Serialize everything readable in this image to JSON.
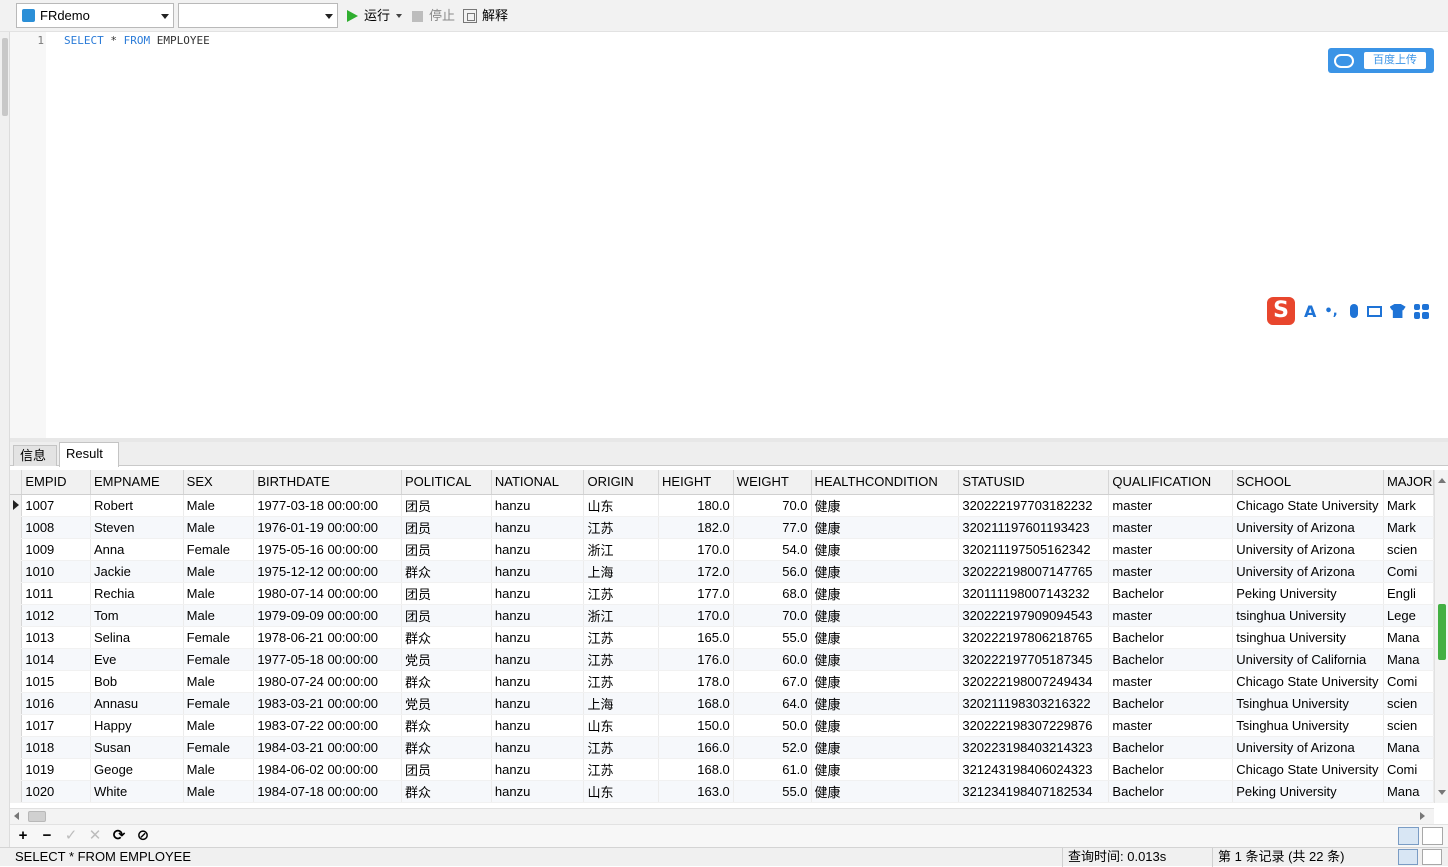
{
  "toolbar": {
    "connection": "FRdemo",
    "database": "",
    "run_label": "运行",
    "stop_label": "停止",
    "explain_label": "解释"
  },
  "editor": {
    "line_number": "1",
    "sql_select": "SELECT",
    "sql_star": " * ",
    "sql_from": "FROM",
    "sql_table": " EMPLOYEE"
  },
  "cloud": {
    "label": "百度上传",
    "icon": "baidu-cloud-icon"
  },
  "ime": {
    "logo": "S",
    "mode": "A",
    "punct": "•,",
    "icons": [
      "mic-icon",
      "keyboard-icon",
      "skin-icon",
      "toolbox-icon"
    ]
  },
  "tabs": [
    {
      "label": "信息",
      "active": false
    },
    {
      "label": "Result 1",
      "active": true
    }
  ],
  "grid": {
    "columns": [
      "EMPID",
      "EMPNAME",
      "SEX",
      "BIRTHDATE",
      "POLITICAL",
      "NATIONAL",
      "ORIGIN",
      "HEIGHT",
      "WEIGHT",
      "HEALTHCONDITION",
      "STATUSID",
      "QUALIFICATION",
      "SCHOOL",
      "MAJOR"
    ],
    "rows": [
      [
        "1007",
        "Robert",
        "Male",
        "1977-03-18 00:00:00",
        "团员",
        "hanzu",
        "山东",
        "180.0",
        "70.0",
        "健康",
        "320222197703182232",
        "master",
        "Chicago State University",
        "Mark"
      ],
      [
        "1008",
        "Steven",
        "Male",
        "1976-01-19 00:00:00",
        "团员",
        "hanzu",
        "江苏",
        "182.0",
        "77.0",
        "健康",
        "320211197601193423",
        "master",
        "University of Arizona",
        "Mark"
      ],
      [
        "1009",
        "Anna",
        "Female",
        "1975-05-16 00:00:00",
        "团员",
        "hanzu",
        "浙江",
        "170.0",
        "54.0",
        "健康",
        "320211197505162342",
        "master",
        "University of Arizona",
        "scien"
      ],
      [
        "1010",
        "Jackie",
        "Male",
        "1975-12-12 00:00:00",
        "群众",
        "hanzu",
        "上海",
        "172.0",
        "56.0",
        "健康",
        "320222198007147765",
        "master",
        "University of Arizona",
        "Comi"
      ],
      [
        "1011",
        "Rechia",
        "Male",
        "1980-07-14 00:00:00",
        "团员",
        "hanzu",
        "江苏",
        "177.0",
        "68.0",
        "健康",
        "320111198007143232",
        "Bachelor",
        "Peking University",
        "Engli"
      ],
      [
        "1012",
        "Tom",
        "Male",
        "1979-09-09 00:00:00",
        "团员",
        "hanzu",
        "浙江",
        "170.0",
        "70.0",
        "健康",
        "320222197909094543",
        "master",
        "tsinghua University",
        "Lege"
      ],
      [
        "1013",
        "Selina",
        "Female",
        "1978-06-21 00:00:00",
        "群众",
        "hanzu",
        "江苏",
        "165.0",
        "55.0",
        "健康",
        "320222197806218765",
        "Bachelor",
        "tsinghua University",
        "Mana"
      ],
      [
        "1014",
        "Eve",
        "Female",
        "1977-05-18 00:00:00",
        "党员",
        "hanzu",
        "江苏",
        "176.0",
        "60.0",
        "健康",
        "320222197705187345",
        "Bachelor",
        "University of California",
        "Mana"
      ],
      [
        "1015",
        "Bob",
        "Male",
        "1980-07-24 00:00:00",
        "群众",
        "hanzu",
        "江苏",
        "178.0",
        "67.0",
        "健康",
        "320222198007249434",
        "master",
        "Chicago State University",
        "Comi"
      ],
      [
        "1016",
        "Annasu",
        "Female",
        "1983-03-21 00:00:00",
        "党员",
        "hanzu",
        "上海",
        "168.0",
        "64.0",
        "健康",
        "320211198303216322",
        "Bachelor",
        "Tsinghua University",
        "scien"
      ],
      [
        "1017",
        "Happy",
        "Male",
        "1983-07-22 00:00:00",
        "群众",
        "hanzu",
        "山东",
        "150.0",
        "50.0",
        "健康",
        "320222198307229876",
        "master",
        "Tsinghua University",
        "scien"
      ],
      [
        "1018",
        "Susan",
        "Female",
        "1984-03-21 00:00:00",
        "群众",
        "hanzu",
        "江苏",
        "166.0",
        "52.0",
        "健康",
        "320223198403214323",
        "Bachelor",
        "University of Arizona",
        "Mana"
      ],
      [
        "1019",
        "Geoge",
        "Male",
        "1984-06-02 00:00:00",
        "团员",
        "hanzu",
        "江苏",
        "168.0",
        "61.0",
        "健康",
        "321243198406024323",
        "Bachelor",
        "Chicago State University",
        "Comi"
      ],
      [
        "1020",
        "White",
        "Male",
        "1984-07-18 00:00:00",
        "群众",
        "hanzu",
        "山东",
        "163.0",
        "55.0",
        "健康",
        "321234198407182534",
        "Bachelor",
        "Peking University",
        "Mana"
      ]
    ]
  },
  "navbar": {
    "add": "+",
    "remove": "−",
    "apply": "✓",
    "cancel": "✕",
    "refresh": "⟳",
    "stop": "⊘"
  },
  "status": {
    "sql": "SELECT * FROM EMPLOYEE",
    "query_time": "查询时间: 0.013s",
    "record": "第 1 条记录 (共 22 条)"
  }
}
